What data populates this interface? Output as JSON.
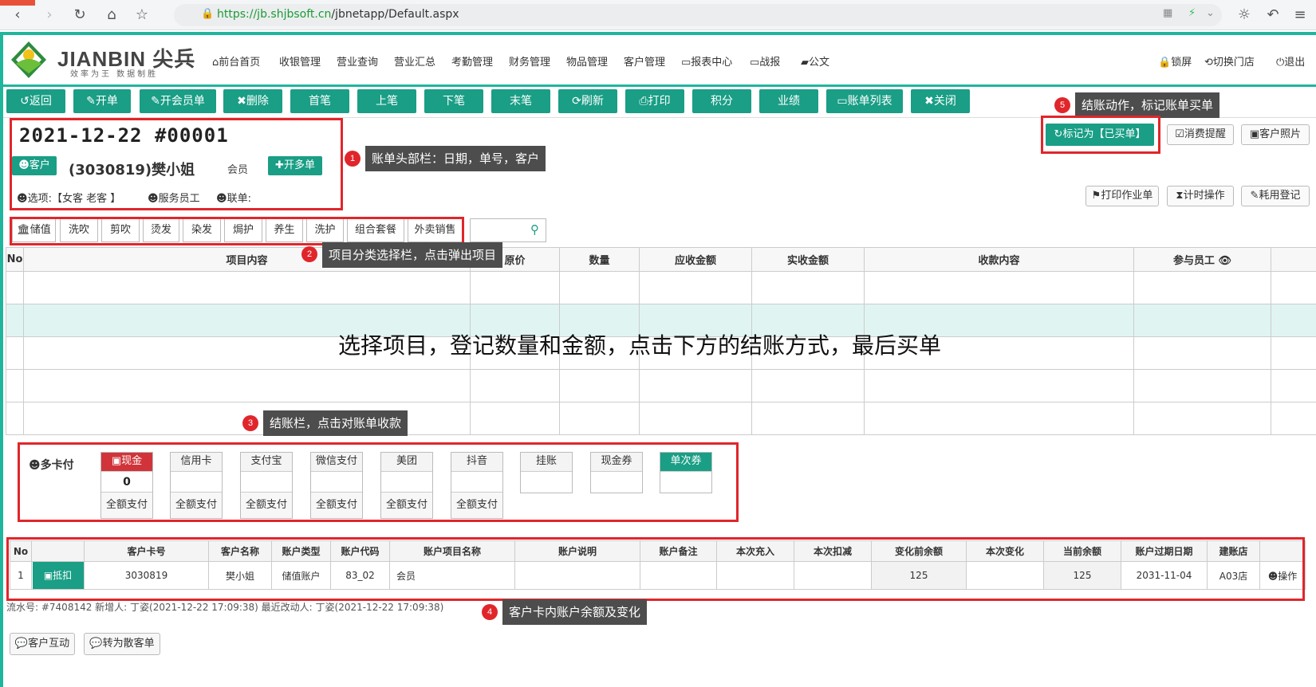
{
  "browser": {
    "url_host": "https://jb.shjbsoft.cn",
    "url_path": "/jbnetapp/Default.aspx"
  },
  "brand": {
    "name": "JIANBIN 尖兵",
    "slogan": "效率为王 数据制胜"
  },
  "nav": {
    "items": [
      "前台首页",
      "收银管理",
      "营业查询",
      "营业汇总",
      "考勤管理",
      "财务管理",
      "物品管理",
      "客户管理",
      "报表中心",
      "战报",
      "公文"
    ],
    "right": [
      "锁屏",
      "切换门店",
      "退出"
    ]
  },
  "toolbar": [
    "返回",
    "开单",
    "开会员单",
    "删除",
    "首笔",
    "上笔",
    "下笔",
    "末笔",
    "刷新",
    "打印",
    "积分",
    "业绩",
    "账单列表",
    "关闭"
  ],
  "bill": {
    "date_no": "2021-12-22  #00001",
    "customer_button": "客户",
    "customer_name": "(3030819)樊小姐",
    "member_type": "会员",
    "multi_button": "开多单",
    "options": "选项:【女客 老客 】",
    "service_staff": "服务员工",
    "linked": "联单:"
  },
  "right_buttons": {
    "mark": "标记为【已买单】",
    "consume_remind": "消费提醒",
    "customer_photo": "客户照片",
    "print_work": "打印作业单",
    "timer": "计时操作",
    "usage": "耗用登记"
  },
  "categories": [
    "储值",
    "洗吹",
    "剪吹",
    "烫发",
    "染发",
    "焗护",
    "养生",
    "洗护",
    "组合套餐",
    "外卖销售"
  ],
  "items_table": {
    "headers": [
      "No",
      "项目内容",
      "原价",
      "数量",
      "应收金额",
      "实收金额",
      "收款内容",
      "参与员工"
    ],
    "overlay_text": "选择项目，登记数量和金额，点击下方的结账方式，最后买单"
  },
  "payment": {
    "multi_label": "多卡付",
    "methods": [
      {
        "name": "现金",
        "value": "0",
        "footer": "全额支付"
      },
      {
        "name": "信用卡",
        "value": "",
        "footer": "全额支付"
      },
      {
        "name": "支付宝",
        "value": "",
        "footer": "全额支付"
      },
      {
        "name": "微信支付",
        "value": "",
        "footer": "全额支付"
      },
      {
        "name": "美团",
        "value": "",
        "footer": "全额支付"
      },
      {
        "name": "抖音",
        "value": "",
        "footer": "全额支付"
      },
      {
        "name": "挂账",
        "value": "",
        "footer": ""
      },
      {
        "name": "现金券",
        "value": "",
        "footer": ""
      },
      {
        "name": "单次券",
        "value": "",
        "footer": ""
      }
    ]
  },
  "accounts": {
    "headers": [
      "No",
      "",
      "客户卡号",
      "客户名称",
      "账户类型",
      "账户代码",
      "账户项目名称",
      "账户说明",
      "账户备注",
      "本次充入",
      "本次扣减",
      "变化前余额",
      "本次变化",
      "当前余额",
      "账户过期日期",
      "建账店",
      ""
    ],
    "row": [
      "1",
      "抵扣",
      "3030819",
      "樊小姐",
      "储值账户",
      "83_02",
      "会员",
      "",
      "",
      "",
      "",
      "125",
      "",
      "125",
      "2031-11-04",
      "A03店",
      "操作"
    ]
  },
  "footer": {
    "info": "流水号: #7408142    新增人: 丁姿(2021-12-22 17:09:38)    最近改动人: 丁姿(2021-12-22 17:09:38)",
    "buttons": [
      "客户互动",
      "转为散客单"
    ]
  },
  "annotations": {
    "a1": "账单头部栏：日期，单号，客户",
    "a2": "项目分类选择栏，点击弹出项目",
    "a3": "结账栏，点击对账单收款",
    "a4": "客户卡内账户余额及变化",
    "a5": "结账动作，标记账单买单",
    "n1": "1",
    "n2": "2",
    "n3": "3",
    "n4": "4",
    "n5": "5"
  },
  "colors": {
    "accent": "#1a9e86",
    "cash_red": "#d0343a",
    "annotation_red": "#e0262b",
    "tip_bg": "#4d4d4d"
  }
}
